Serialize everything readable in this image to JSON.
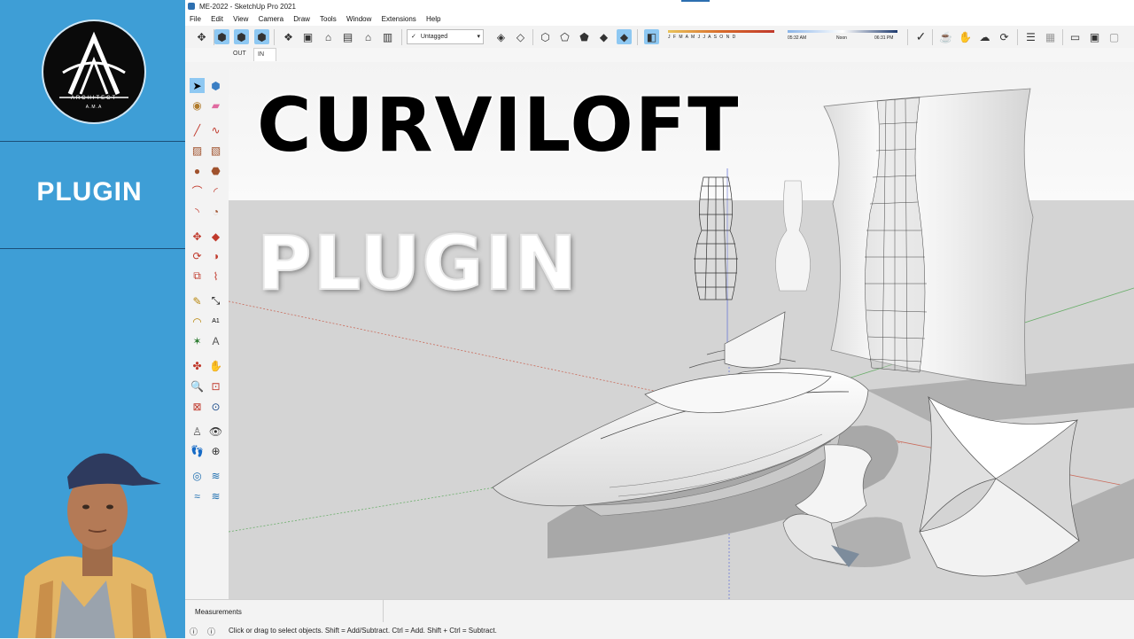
{
  "window": {
    "title": "ME-2022 - SketchUp Pro 2021"
  },
  "brand": {
    "section_label": "PLUGIN",
    "logo_text": "ARCHITECT",
    "logo_sub": "A.M.A"
  },
  "menu": [
    "File",
    "Edit",
    "View",
    "Camera",
    "Draw",
    "Tools",
    "Window",
    "Extensions",
    "Help"
  ],
  "toolbar": {
    "tag_value": "Untagged",
    "months": "J F M A M J J A S O N D",
    "time_start": "05:32 AM",
    "time_noon": "Noon",
    "time_end": "06:31 PM"
  },
  "section_tabs": {
    "out": "OUT",
    "in": "IN"
  },
  "overlay": {
    "line1": "CURVILOFT",
    "line2": "PLUGIN"
  },
  "status": {
    "measurements_label": "Measurements",
    "hint": "Click or drag to select objects. Shift = Add/Subtract. Ctrl = Add. Shift + Ctrl = Subtract."
  },
  "colors": {
    "brand_blue": "#3e9ed6",
    "selected_tool": "#8ec8f2",
    "ground": "#d4d4d4",
    "sky": "#f5f5f5"
  }
}
